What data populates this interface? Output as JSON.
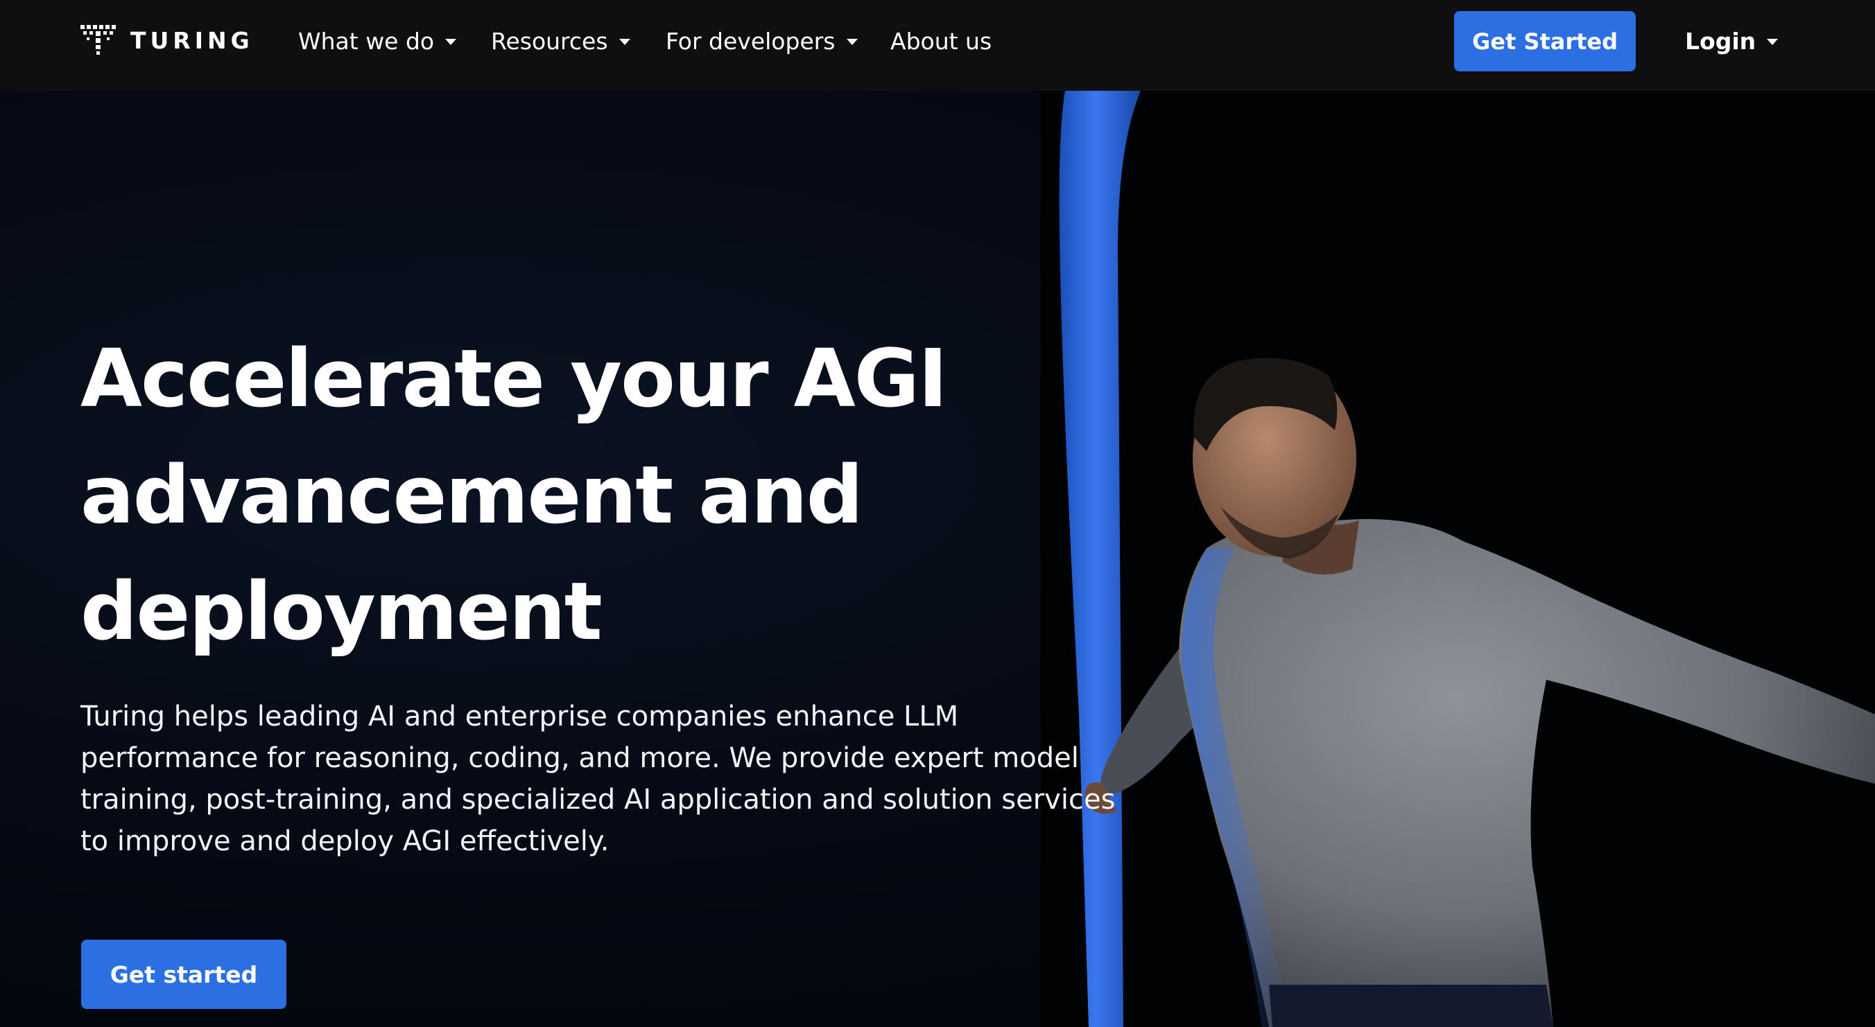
{
  "brand": {
    "name": "TURING",
    "logo_icon": "turing-logo-icon"
  },
  "nav": {
    "items": [
      {
        "label": "What we do",
        "has_dropdown": true
      },
      {
        "label": "Resources",
        "has_dropdown": true
      },
      {
        "label": "For developers",
        "has_dropdown": true
      },
      {
        "label": "About us",
        "has_dropdown": false
      }
    ],
    "cta_label": "Get Started",
    "login_label": "Login"
  },
  "hero": {
    "title": "Accelerate your AGI advancement and deployment",
    "subtitle": "Turing helps leading AI and enterprise companies enhance LLM performance for reasoning, coding, and more. We provide expert model training, post-training, and specialized AI application and solution services to improve and deploy AGI effectively.",
    "cta_label": "Get started",
    "image": "man-in-gray-sweater-beside-blue-light-panel"
  },
  "colors": {
    "nav_bg": "#0f0f10",
    "hero_bg": "#04070f",
    "accent_blue": "#2c6fe3",
    "text": "#ffffff"
  }
}
